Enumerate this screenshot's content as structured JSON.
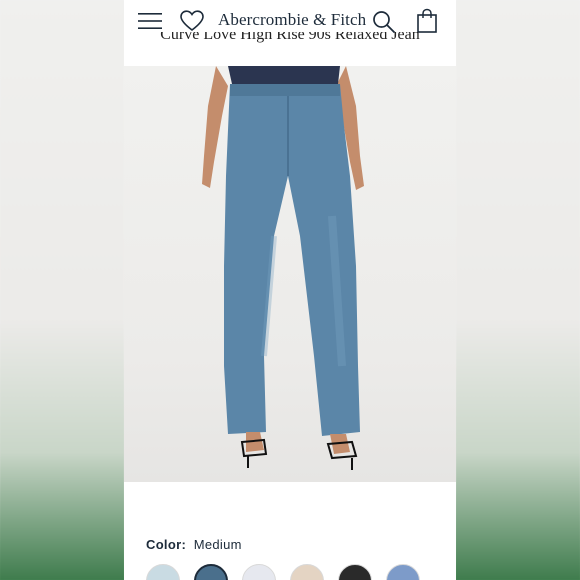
{
  "header": {
    "brand": "Abercrombie & Fitch",
    "product_title": "Curve Love High Rise 90s Relaxed Jean"
  },
  "icons": {
    "menu": "hamburger-menu-icon",
    "favorites": "heart-icon",
    "search": "search-icon",
    "cart": "shopping-bag-icon"
  },
  "product": {
    "image_alt": "Model wearing medium wash relaxed wide-leg jeans with black strappy sandals",
    "color_label": "Color:",
    "color_value": "Medium",
    "swatches": [
      {
        "name": "light",
        "color": "#c9dbe3"
      },
      {
        "name": "medium",
        "color": "#4a6f8c",
        "selected": true
      },
      {
        "name": "white",
        "color": "#e6e8ef"
      },
      {
        "name": "tan",
        "color": "#e4d4c3"
      },
      {
        "name": "black",
        "color": "#2a2a2a"
      },
      {
        "name": "bright-blue",
        "color": "#7d9bc9"
      }
    ]
  },
  "colors": {
    "brand_navy": "#1d2b3a",
    "denim": "#5b86a8",
    "bodysuit": "#2b3550"
  }
}
